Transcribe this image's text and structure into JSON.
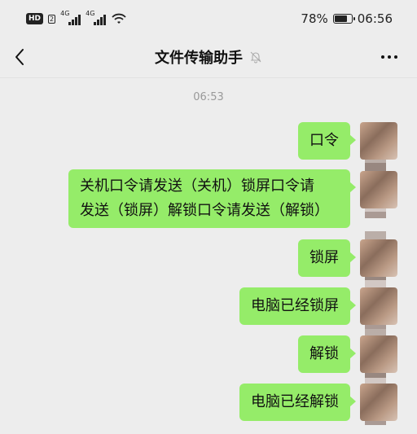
{
  "status_bar": {
    "hd_label": "HD",
    "sim_label": "2",
    "signal1_label": "4G",
    "signal2_label": "4G",
    "battery_percent": "78%",
    "battery_level": 0.78,
    "time": "06:56"
  },
  "nav": {
    "title": "文件传输助手"
  },
  "chat": {
    "timestamp": "06:53",
    "messages": [
      {
        "text": "口令"
      },
      {
        "line1": "关机口令请发送（关机）锁屏口令请",
        "line2": "发送（锁屏）解锁口令请发送（解锁）"
      },
      {
        "text": "锁屏"
      },
      {
        "text": "电脑已经锁屏"
      },
      {
        "text": "解锁"
      },
      {
        "text": "电脑已经解锁"
      }
    ]
  },
  "colors": {
    "bubble_sent": "#95ec69",
    "background": "#ededed"
  },
  "icons": {
    "back": "chevron-left-icon",
    "mute": "bell-off-icon",
    "more": "ellipsis-icon",
    "wifi": "wifi-icon",
    "battery": "battery-icon"
  }
}
